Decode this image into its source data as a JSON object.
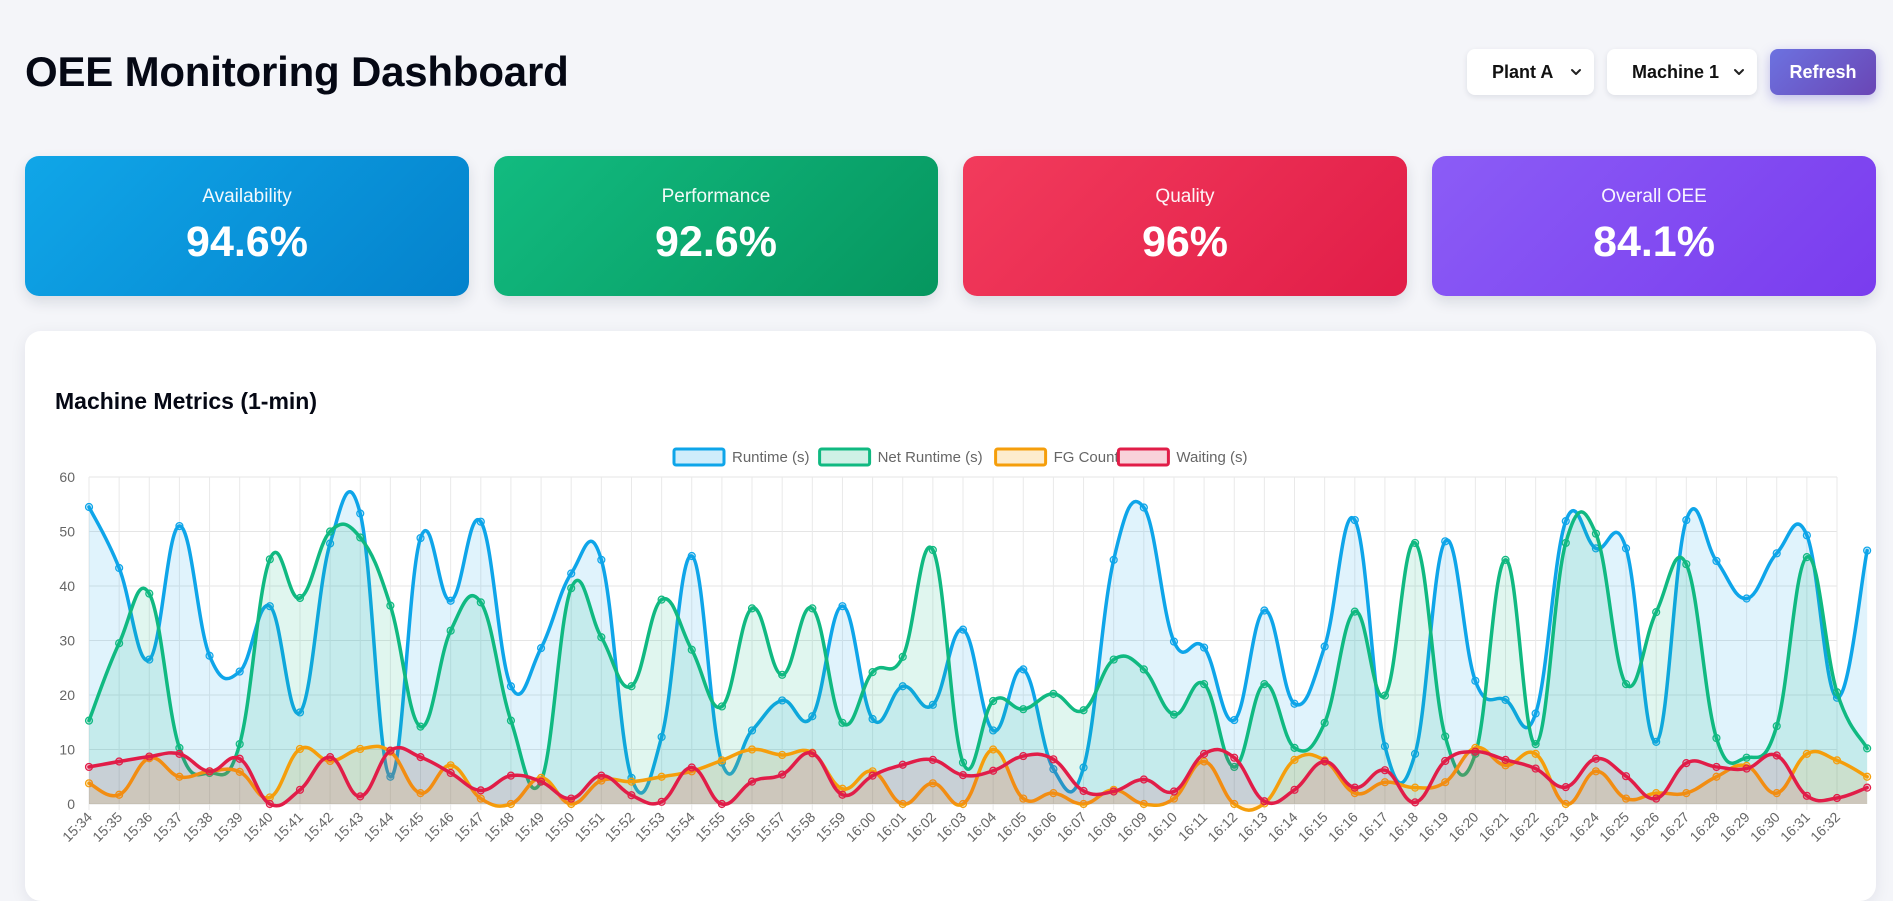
{
  "header": {
    "title": "OEE Monitoring Dashboard",
    "plant_select": "Plant A",
    "machine_select": "Machine 1",
    "refresh_label": "Refresh"
  },
  "kpis": [
    {
      "label": "Availability",
      "value": "94.6%",
      "color": "#0EA5E9"
    },
    {
      "label": "Performance",
      "value": "92.6%",
      "color": "#10B981"
    },
    {
      "label": "Quality",
      "value": "96%",
      "color": "#F43F5E"
    },
    {
      "label": "Overall OEE",
      "value": "84.1%",
      "color": "#8B5CF6"
    }
  ],
  "chart_card": {
    "title": "Machine Metrics (1-min)"
  },
  "chart_data": {
    "type": "line",
    "x": [
      "15:34",
      "15:35",
      "15:36",
      "15:37",
      "15:38",
      "15:39",
      "15:40",
      "15:41",
      "15:42",
      "15:43",
      "15:44",
      "15:45",
      "15:46",
      "15:47",
      "15:48",
      "15:49",
      "15:50",
      "15:51",
      "15:52",
      "15:53",
      "15:54",
      "15:55",
      "15:56",
      "15:57",
      "15:58",
      "15:59",
      "16:00",
      "16:01",
      "16:02",
      "16:03",
      "16:04",
      "16:05",
      "16:06",
      "16:07",
      "16:08",
      "16:09",
      "16:10",
      "16:11",
      "16:12",
      "16:13",
      "16:14",
      "16:15",
      "16:16",
      "16:17",
      "16:18",
      "16:19",
      "16:20",
      "16:21",
      "16:22",
      "16:23",
      "16:24",
      "16:25",
      "16:26",
      "16:27",
      "16:28",
      "16:29",
      "16:30",
      "16:31",
      "16:32"
    ],
    "ylim": [
      0,
      60
    ],
    "yticks": [
      0,
      10,
      20,
      30,
      40,
      50,
      60
    ],
    "grid": true,
    "legend_position": "top-center",
    "series": [
      {
        "name": "Runtime (s)",
        "color": "#0EA5E9",
        "values": [
          54.5,
          43.3,
          26.5,
          51,
          27.2,
          24.3,
          36.3,
          16.8,
          47.8,
          53.3,
          5,
          48.8,
          37.3,
          51.8,
          21.6,
          28.6,
          42.3,
          44.8,
          4.8,
          12.3,
          45.5,
          7.6,
          13.5,
          19,
          16.1,
          36.3,
          15.6,
          21.6,
          18.2,
          32,
          13.5,
          24.7,
          6.4,
          6.7,
          44.8,
          54.4,
          29.8,
          28.7,
          15.4,
          35.5,
          18.4,
          28.9,
          52.1,
          10.6,
          9.2,
          48.2,
          22.6,
          19.1,
          16.6,
          51.9,
          46.9,
          46.9,
          11.4,
          52.1,
          44.6,
          37.7,
          46,
          49.3,
          19.5,
          46.5
        ]
      },
      {
        "name": "Net Runtime (s)",
        "color": "#10B981",
        "values": [
          15.3,
          29.5,
          38.6,
          10.3,
          5.7,
          11,
          44.9,
          37.8,
          50,
          48.9,
          36.4,
          14.2,
          31.8,
          37,
          15.3,
          4.2,
          39.6,
          30.6,
          21.6,
          37.5,
          28.3,
          17.9,
          35.9,
          23.7,
          35.9,
          14.9,
          24.2,
          27,
          46.6,
          7.6,
          18.9,
          17.4,
          20.2,
          17.2,
          26.5,
          24.7,
          16.4,
          22,
          6.8,
          22,
          10.3,
          14.9,
          35.3,
          19.9,
          47.9,
          12.4,
          9.2,
          44.8,
          11,
          47.9,
          49.6,
          22,
          35.2,
          44,
          12.1,
          8.5,
          14.3,
          45.3,
          20.5,
          10.2
        ]
      },
      {
        "name": "FG Count",
        "color": "#F59E0B",
        "values": [
          3.8,
          1.7,
          8.4,
          5,
          6,
          5.9,
          1.2,
          10.1,
          7.9,
          10.1,
          9.6,
          2,
          7.1,
          1,
          0,
          4.8,
          0,
          4.3,
          4.1,
          5,
          6,
          8,
          10,
          9,
          9.4,
          2.8,
          6,
          0,
          3.8,
          0,
          10,
          1,
          2,
          0,
          2.6,
          0,
          1,
          7.8,
          0,
          0.1,
          8.1,
          8,
          2,
          4,
          3,
          4,
          10.3,
          7.1,
          9.2,
          0,
          6,
          1,
          2,
          2,
          5,
          7,
          2,
          9.2,
          8,
          5
        ]
      },
      {
        "name": "Waiting (s)",
        "color": "#E11D48",
        "values": [
          6.8,
          7.8,
          8.7,
          9.2,
          6,
          8.3,
          0,
          2.6,
          8.6,
          1.4,
          9.8,
          8.6,
          5.7,
          2.5,
          5.2,
          4.1,
          1,
          5.2,
          1.6,
          0.4,
          6.7,
          0,
          4.1,
          5.4,
          9.3,
          1.7,
          5.2,
          7.2,
          8.1,
          5.3,
          6.1,
          8.8,
          8.2,
          2.4,
          2.3,
          4.5,
          2.3,
          9.2,
          8.5,
          0.5,
          2.6,
          7.8,
          3,
          6.2,
          0.3,
          7.9,
          9.6,
          8.1,
          6.5,
          3.1,
          8.3,
          5.1,
          1,
          7.5,
          6.8,
          6.5,
          8.9,
          1.5,
          1.1,
          3
        ]
      }
    ]
  }
}
